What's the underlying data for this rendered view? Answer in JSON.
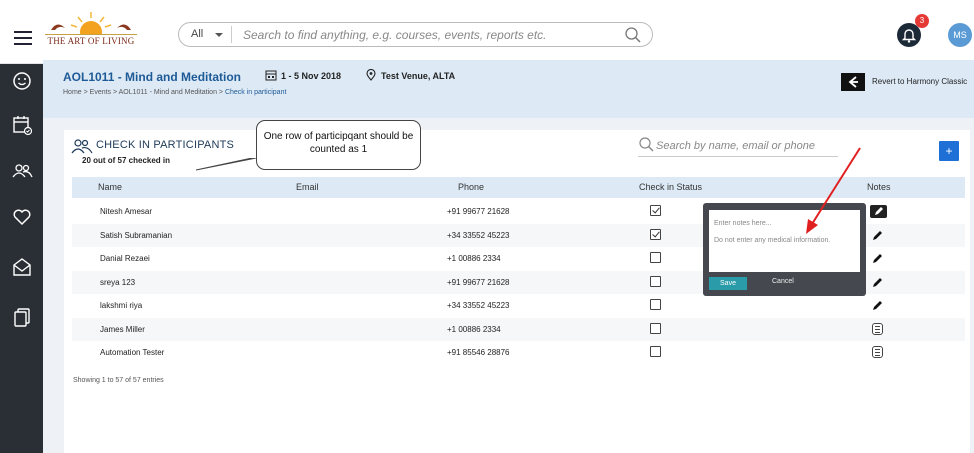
{
  "header": {
    "logo_text": "THE ART OF LIVING",
    "search_filter": "All",
    "search_placeholder": "Search to find anything, e.g. courses, events, reports etc.",
    "notification_count": "3",
    "user_initials": "MS"
  },
  "event": {
    "title": "AOL1011 - Mind and Meditation",
    "date": "1 - 5 Nov 2018",
    "venue": "Test Venue, ALTA",
    "breadcrumb_prefix": "Home > Events > AOL1011 - Mind and Meditation > ",
    "breadcrumb_current": "Check in participant",
    "revert_label": "Revert to Harmony Classic"
  },
  "card": {
    "title": "CHECK IN PARTICIPANTS",
    "subtitle": "20 out of 57 checked in",
    "callout": "One row of participqant should be counted as 1",
    "search_placeholder": "Search by name, email or phone",
    "add_label": "+",
    "footer": "Showing 1 to 57 of 57 entries"
  },
  "table": {
    "columns": [
      "Name",
      "Email",
      "Phone",
      "Check in Status",
      "Notes"
    ],
    "rows": [
      {
        "name": "Nitesh Amesar",
        "email": "",
        "phone": "+91 99677 21628",
        "checked": true,
        "note": "pencil-active"
      },
      {
        "name": "Satish Subramanian",
        "email": "",
        "phone": "+34 33552 45223",
        "checked": true,
        "note": "pencil"
      },
      {
        "name": "Danial Rezaei",
        "email": "",
        "phone": "+1 00886 2334",
        "checked": false,
        "note": "pencil"
      },
      {
        "name": "sreya 123",
        "email": "",
        "phone": "+91 99677 21628",
        "checked": false,
        "note": "pencil"
      },
      {
        "name": "lakshmi riya",
        "email": "",
        "phone": "+34 33552 45223",
        "checked": false,
        "note": "pencil"
      },
      {
        "name": "James Miller",
        "email": "",
        "phone": "+1 00886 2334",
        "checked": false,
        "note": "note"
      },
      {
        "name": "Automation Tester",
        "email": "",
        "phone": "+91 85546 28876",
        "checked": false,
        "note": "note"
      }
    ]
  },
  "popup": {
    "placeholder": "Enter notes here...",
    "warning": "Do not enter any medical information.",
    "save": "Save",
    "cancel": "Cancel"
  },
  "colors": {
    "accent": "#1e5a96",
    "sidebar": "#2a2f36",
    "annotation_arrow": "#e02020"
  }
}
